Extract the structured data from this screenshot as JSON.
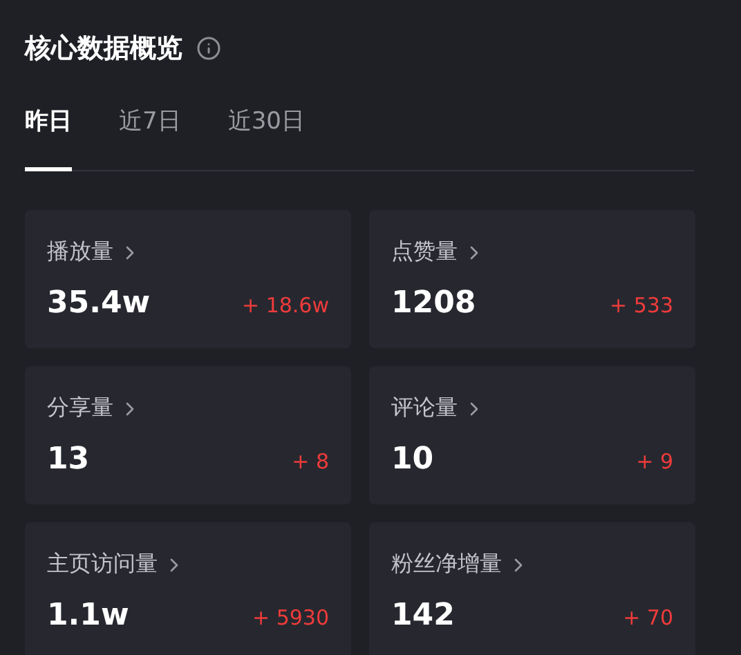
{
  "title": "核心数据概览",
  "tabs": [
    {
      "label": "昨日",
      "selected": true
    },
    {
      "label": "近7日",
      "selected": false
    },
    {
      "label": "近30日",
      "selected": false
    }
  ],
  "metrics": [
    {
      "label": "播放量",
      "value": "35.4w",
      "change": "+ 18.6w"
    },
    {
      "label": "点赞量",
      "value": "1208",
      "change": "+ 533"
    },
    {
      "label": "分享量",
      "value": "13",
      "change": "+ 8"
    },
    {
      "label": "评论量",
      "value": "10",
      "change": "+ 9"
    },
    {
      "label": "主页访问量",
      "value": "1.1w",
      "change": "+ 5930"
    },
    {
      "label": "粉丝净增量",
      "value": "142",
      "change": "+ 70"
    }
  ]
}
